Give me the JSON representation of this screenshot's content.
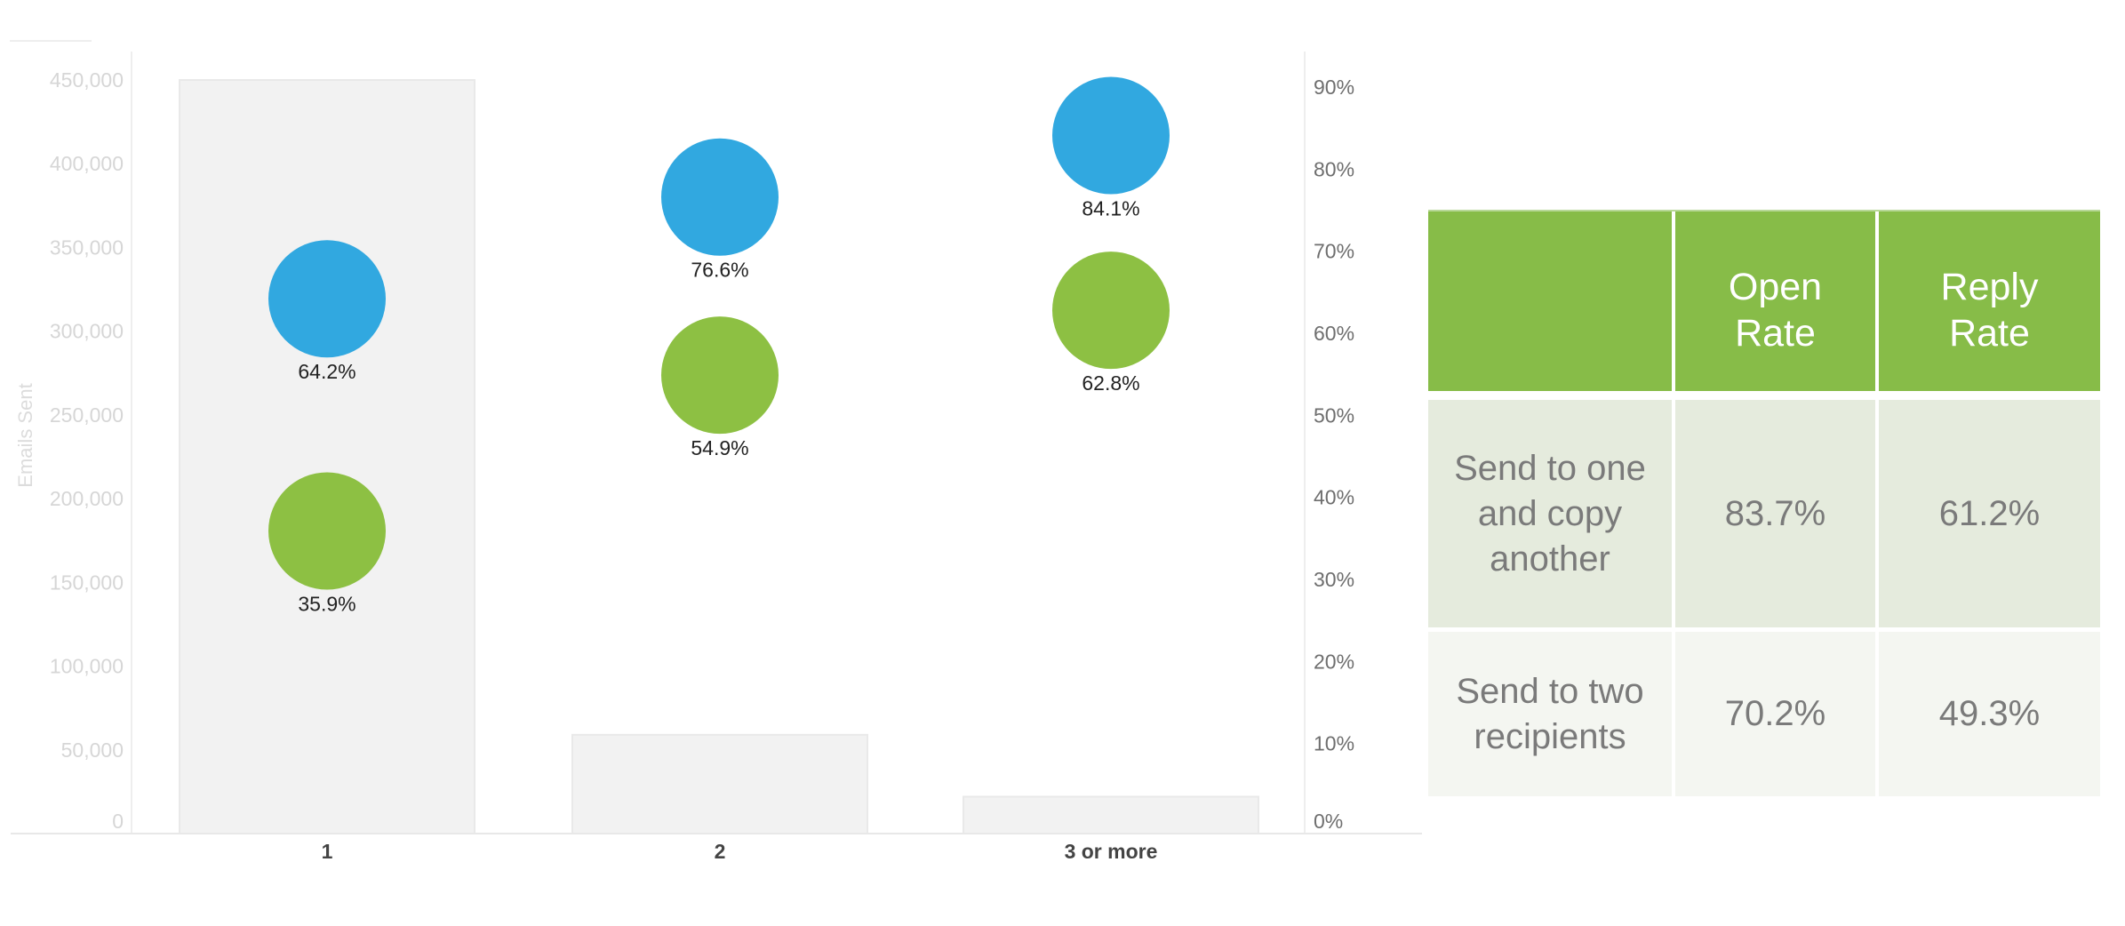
{
  "chart_data": {
    "type": "bar",
    "title": "",
    "xlabel": "",
    "ylabel": "Emails Sent",
    "y2label": "",
    "categories": [
      "1",
      "2",
      "3 or more"
    ],
    "ylim": [
      0,
      450000
    ],
    "y_ticks": [
      "0",
      "50,000",
      "100,000",
      "150,000",
      "200,000",
      "250,000",
      "300,000",
      "350,000",
      "400,000",
      "450,000"
    ],
    "y_tick_values": [
      0,
      50000,
      100000,
      150000,
      200000,
      250000,
      300000,
      350000,
      400000,
      450000
    ],
    "y2lim": [
      0,
      90
    ],
    "y2_ticks": [
      "0%",
      "10%",
      "20%",
      "30%",
      "40%",
      "50%",
      "60%",
      "70%",
      "80%",
      "90%"
    ],
    "y2_tick_values": [
      0,
      10,
      20,
      30,
      40,
      50,
      60,
      70,
      80,
      90
    ],
    "grid": false,
    "legend": "none",
    "bars": {
      "name": "Emails Sent",
      "axis": "left",
      "color": "#f2f2f2",
      "values": [
        450000,
        59000,
        22000
      ]
    },
    "series": [
      {
        "name": "Open Rate",
        "type": "bubble",
        "axis": "right",
        "color": "#31a8e0",
        "values": [
          64.2,
          76.6,
          84.1
        ],
        "labels": [
          "64.2%",
          "76.6%",
          "84.1%"
        ]
      },
      {
        "name": "Reply Rate",
        "type": "bubble",
        "axis": "right",
        "color": "#8dc043",
        "values": [
          35.9,
          54.9,
          62.8
        ],
        "labels": [
          "35.9%",
          "54.9%",
          "62.8%"
        ]
      }
    ]
  },
  "table": {
    "header_color": "#87bc48",
    "row_colors": [
      "#e5ebdd",
      "#f4f6f1"
    ],
    "headers": [
      "",
      "Open\nRate",
      "Reply\nRate"
    ],
    "header_lines": [
      [],
      [
        "Open",
        "Rate"
      ],
      [
        "Reply",
        "Rate"
      ]
    ],
    "rows": [
      {
        "label_lines": [
          "Send to one",
          "and copy",
          "another"
        ],
        "label": "Send to one and copy another",
        "open_rate": "83.7%",
        "reply_rate": "61.2%"
      },
      {
        "label_lines": [
          "Send to two",
          "recipients"
        ],
        "label": "Send to two recipients",
        "open_rate": "70.2%",
        "reply_rate": "49.3%"
      }
    ]
  }
}
